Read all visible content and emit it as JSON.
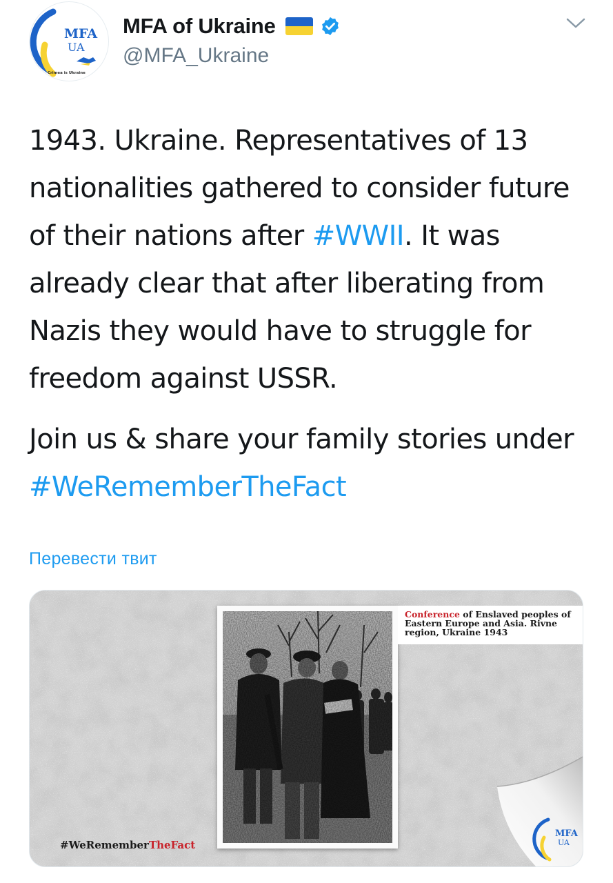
{
  "author": {
    "display_name": "MFA of Ukraine",
    "handle": "@MFA_Ukraine",
    "avatar": {
      "logo_top": "MFA",
      "logo_bottom": "UA",
      "tagline": "Crimea is Ukraine"
    },
    "flag_icon": "ukraine-flag-icon",
    "verified_icon": "verified-badge-icon"
  },
  "tweet": {
    "paragraph1": {
      "part1": "1943. Ukraine. Representatives of 13 nationalities gathered to consider future of their nations after ",
      "hashtag": "#WWII",
      "part2": ". It was already clear that after liberating from Nazis they would have to struggle for freedom against USSR."
    },
    "paragraph2": {
      "part1": "Join us & share your family stories under ",
      "hashtag": "#WeRememberTheFact"
    }
  },
  "translate_link": "Перевести твит",
  "media": {
    "caption_red": "Conference",
    "caption_rest": " of Enslaved peoples of Eastern Europe and Asia. Rivne region, Ukraine 1943",
    "hashtag_dark": "#WeRemember",
    "hashtag_red": "TheFact",
    "logo_top": "MFA",
    "logo_bottom": "UA"
  },
  "colors": {
    "link": "#1d9bf0",
    "text": "#14171a",
    "secondary": "#657786",
    "flag_blue": "#1d63c8",
    "flag_yellow": "#f6d232",
    "accent_red": "#c8222a"
  }
}
